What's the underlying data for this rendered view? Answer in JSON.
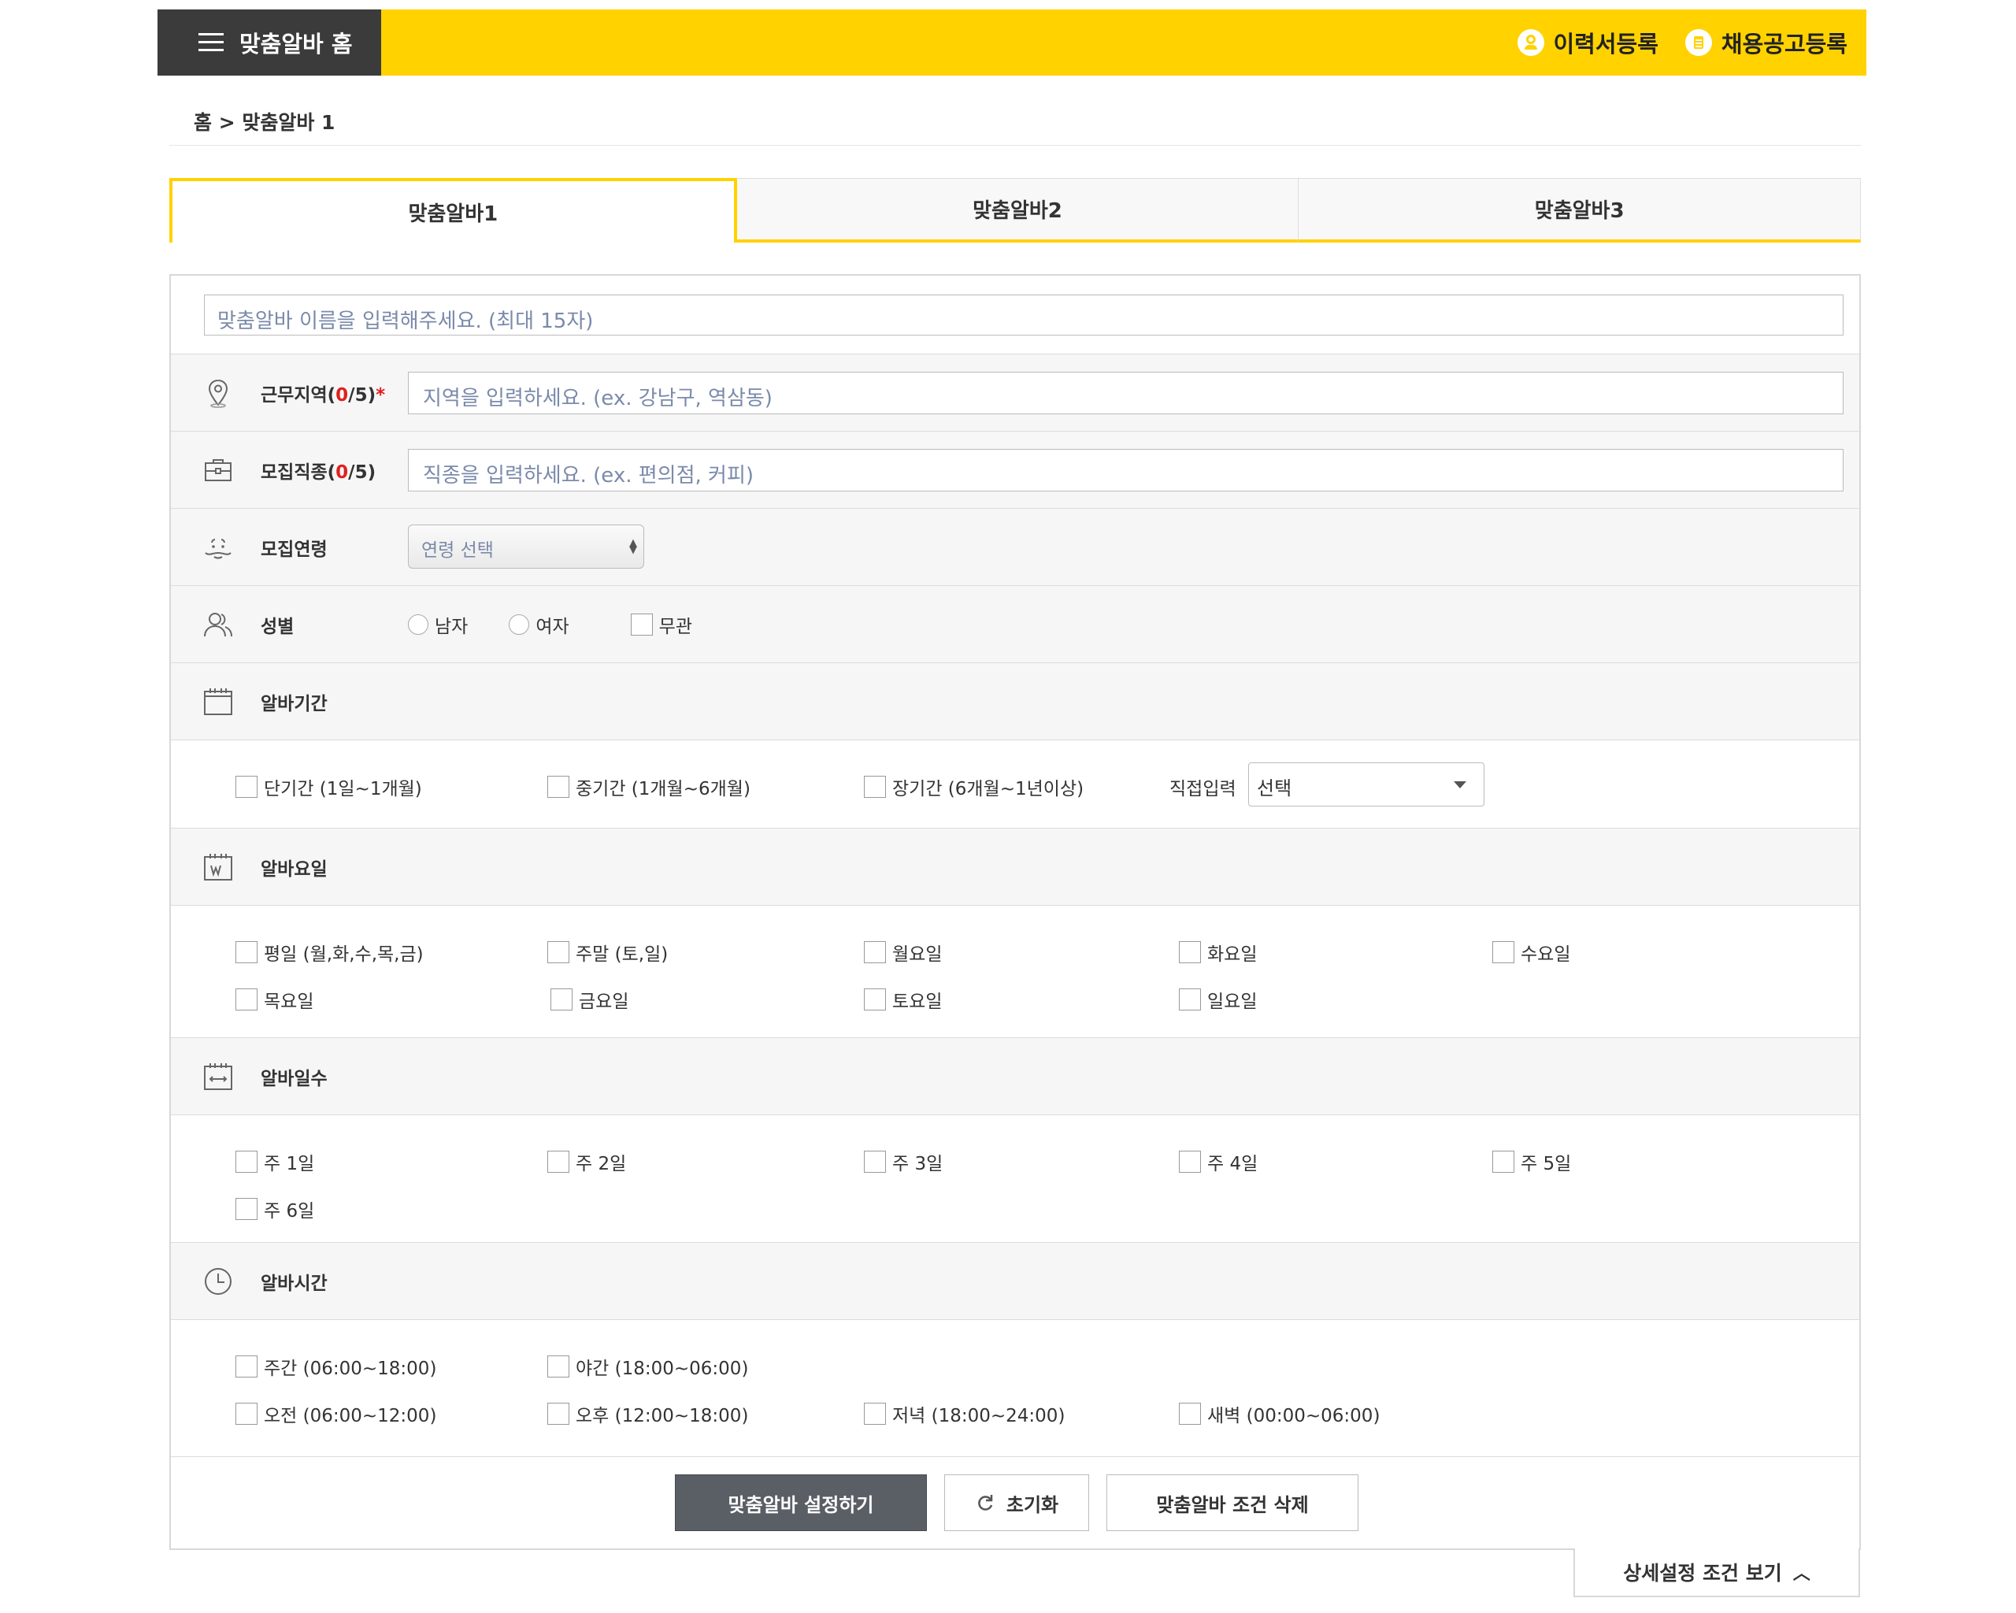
{
  "header": {
    "home_label": "맞춤알바 홈",
    "resume_label": "이력서등록",
    "job_post_label": "채용공고등록",
    "accent_color": "#ffd200"
  },
  "breadcrumb": "홈 > 맞춤알바 1",
  "tabs": [
    {
      "label": "맞춤알바1",
      "active": true
    },
    {
      "label": "맞춤알바2",
      "active": false
    },
    {
      "label": "맞춤알바3",
      "active": false
    }
  ],
  "form": {
    "name_placeholder": "맞춤알바 이름을 입력해주세요. (최대 15자)",
    "region": {
      "label": "근무지역",
      "count_prefix": "(",
      "count": "0",
      "count_suffix": "/5)",
      "required": "*",
      "placeholder": "지역을 입력하세요. (ex. 강남구, 역삼동)"
    },
    "job": {
      "label": "모집직종",
      "count_prefix": "(",
      "count": "0",
      "count_suffix": "/5)",
      "placeholder": "직종을 입력하세요. (ex. 편의점, 커피)"
    },
    "age": {
      "label": "모집연령",
      "select_value": "연령 선택"
    },
    "gender": {
      "label": "성별",
      "options": [
        "남자",
        "여자",
        "무관"
      ]
    },
    "period": {
      "label": "알바기간",
      "options": [
        "단기간 (1일~1개월)",
        "중기간 (1개월~6개월)",
        "장기간 (6개월~1년이상)"
      ],
      "direct_label": "직접입력",
      "direct_value": "선택"
    },
    "weekday": {
      "label": "알바요일",
      "options": [
        "평일 (월,화,수,목,금)",
        "주말 (토,일)",
        "월요일",
        "화요일",
        "수요일",
        "목요일",
        "금요일",
        "토요일",
        "일요일"
      ]
    },
    "days": {
      "label": "알바일수",
      "options": [
        "주 1일",
        "주 2일",
        "주 3일",
        "주 4일",
        "주 5일",
        "주 6일"
      ]
    },
    "time": {
      "label": "알바시간",
      "options": [
        "주간 (06:00~18:00)",
        "야간 (18:00~06:00)",
        "오전 (06:00~12:00)",
        "오후 (12:00~18:00)",
        "저녁 (18:00~24:00)",
        "새벽 (00:00~06:00)"
      ]
    }
  },
  "buttons": {
    "save": "맞춤알바 설정하기",
    "reset": "초기화",
    "delete": "맞춤알바 조건 삭제"
  },
  "detail_toggle": "상세설정 조건 보기"
}
